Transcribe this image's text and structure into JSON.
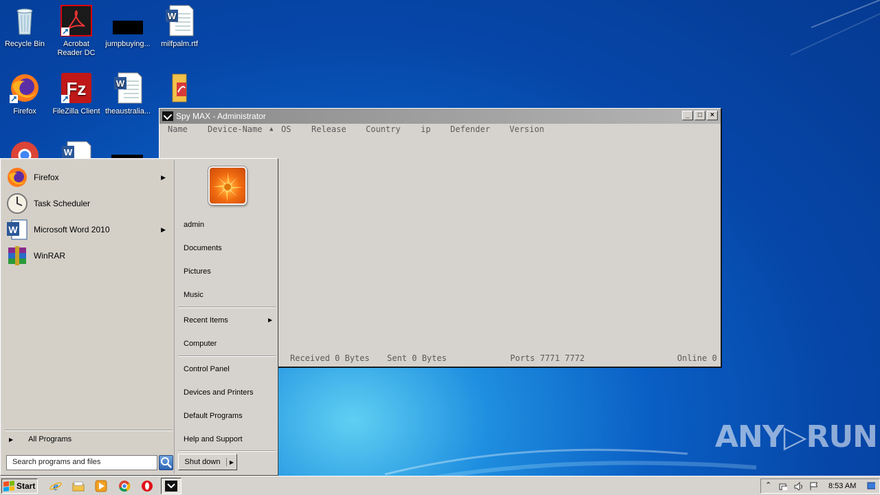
{
  "desktop": {
    "icons": [
      {
        "label": "Recycle Bin"
      },
      {
        "label": "Acrobat Reader DC"
      },
      {
        "label": "jumpbuying..."
      },
      {
        "label": "milfpalm.rtf"
      },
      {
        "label": "Firefox"
      },
      {
        "label": "FileZilla Client"
      },
      {
        "label": "theaustralia..."
      },
      {
        "label": ""
      }
    ]
  },
  "window": {
    "title": "Spy MAX - Administrator",
    "buttons": {
      "minimize": "_",
      "maximize": "□",
      "close": "×"
    },
    "columns": [
      "Name",
      "Device-Name",
      "▲",
      "OS",
      "Release",
      "Country",
      "ip",
      "Defender",
      "Version"
    ],
    "status": {
      "received": "Received 0 Bytes",
      "sent": "Sent 0 Bytes",
      "ports": "Ports 7771 7772",
      "online": "Online 0"
    }
  },
  "start_menu": {
    "programs": [
      {
        "label": "Firefox",
        "has_submenu": true,
        "icon": "firefox-icon"
      },
      {
        "label": "Task Scheduler",
        "has_submenu": false,
        "icon": "clock-icon"
      },
      {
        "label": "Microsoft Word 2010",
        "has_submenu": true,
        "icon": "word-icon"
      },
      {
        "label": "WinRAR",
        "has_submenu": false,
        "icon": "winrar-icon"
      }
    ],
    "all_programs": "All Programs",
    "search_placeholder": "Search programs and files",
    "right_links": {
      "user": "admin",
      "documents": "Documents",
      "pictures": "Pictures",
      "music": "Music",
      "recent_items": "Recent Items",
      "computer": "Computer",
      "control_panel": "Control Panel",
      "devices_printers": "Devices and Printers",
      "default_programs": "Default Programs",
      "help_support": "Help and Support"
    },
    "shutdown": "Shut down"
  },
  "taskbar": {
    "start_label": "Start",
    "clock": "8:53 AM"
  },
  "watermark": "ANY▷RUN"
}
